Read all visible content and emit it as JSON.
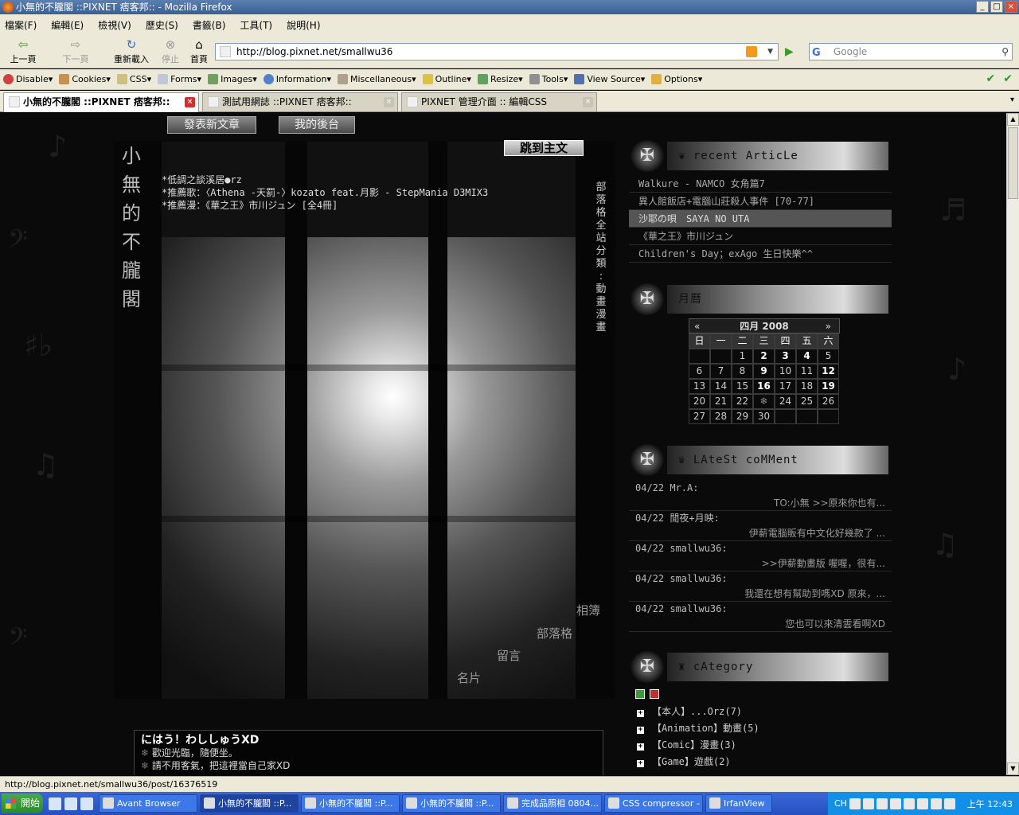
{
  "window": {
    "title": "小無的不朧閣 ::PIXNET 痞客邦:: - Mozilla Firefox"
  },
  "menu": [
    "檔案(F)",
    "編輯(E)",
    "檢視(V)",
    "歷史(S)",
    "書籤(B)",
    "工具(T)",
    "說明(H)"
  ],
  "nav": {
    "back": "上一頁",
    "forward": "下一頁",
    "reload": "重新載入",
    "stop": "停止",
    "home": "首頁",
    "url": "http://blog.pixnet.net/smallwu36",
    "search_placeholder": "Google"
  },
  "devbar": [
    "Disable▾",
    "Cookies▾",
    "CSS▾",
    "Forms▾",
    "Images▾",
    "Information▾",
    "Miscellaneous▾",
    "Outline▾",
    "Resize▾",
    "Tools▾",
    "View Source▾",
    "Options▾"
  ],
  "tabs": [
    "小無的不朧閣 ::PIXNET 痞客邦::",
    "測試用網誌 ::PIXNET 痞客邦::",
    "PIXNET 管理介面 :: 編輯CSS"
  ],
  "blog": {
    "btn_new_post": "發表新文章",
    "btn_backend": "我的後台",
    "btn_jump": "跳到主文",
    "title_chars": [
      "小",
      "無",
      "的",
      "不",
      "朧",
      "閣"
    ],
    "motto": [
      "*低調之談溪居●rz",
      "*推薦歌：〈Athena -天罰-〉kozato feat.月影 - StepMania D3MIX3",
      "*推薦漫：《華之王》市川ジュン [全4冊]"
    ],
    "breadcrumb_chars": [
      "部",
      "落",
      "格",
      "全",
      "站",
      "分",
      "類",
      ":",
      "動",
      "畫",
      "漫",
      "畫"
    ],
    "banner_nav": {
      "album": "相簿",
      "blog": "部落格",
      "guestbook": "留言",
      "card": "名片"
    },
    "welcome": {
      "title": "にはう！わししゅうXD",
      "lines": [
        "歡迎光臨，隨便坐。",
        "請不用客氣，把這裡當自己家XD"
      ]
    }
  },
  "sidebar": {
    "recent": {
      "title": "❦ recent ArticLe",
      "items": [
        "Walkure - NAMCO 女角篇7",
        "異人館飯店+電腦山莊殺人事件 [70-77]",
        "沙耶の唄　SAYA NO UTA",
        "《華之王》市川ジュン",
        "Children's Day；exAgo 生日快樂^^"
      ]
    },
    "calendar": {
      "title": "月曆",
      "prev": "«",
      "next": "»",
      "month": "四月 2008",
      "dow": [
        "日",
        "一",
        "二",
        "三",
        "四",
        "五",
        "六"
      ],
      "weeks": [
        [
          "",
          "",
          "1",
          "2",
          "3",
          "4",
          "5"
        ],
        [
          "6",
          "7",
          "8",
          "9",
          "10",
          "11",
          "12"
        ],
        [
          "13",
          "14",
          "15",
          "16",
          "17",
          "18",
          "19"
        ],
        [
          "20",
          "21",
          "22",
          "❄",
          "24",
          "25",
          "26"
        ],
        [
          "27",
          "28",
          "29",
          "30",
          "",
          "",
          ""
        ]
      ]
    },
    "comments": {
      "title": "♛ LAteSt coMMent",
      "items": [
        {
          "who": "04/22 Mr.A:",
          "text": "TO:小無 >>原來你也有..."
        },
        {
          "who": "04/22 閒夜+月映:",
          "text": "伊薪電腦販有中文化好幾款了 ..."
        },
        {
          "who": "04/22 smallwu36:",
          "text": ">>伊薪動畫版 喔喔，很有..."
        },
        {
          "who": "04/22 smallwu36:",
          "text": "我還在想有幫助到嗎XD 原來，..."
        },
        {
          "who": "04/22 smallwu36:",
          "text": "您也可以來清雲看啊XD"
        }
      ]
    },
    "category": {
      "title": "♜ cAtegory",
      "items": [
        "【本人】...Orz(7)",
        "【Animation】動畫(5)",
        "【Comic】漫畫(3)",
        "【Game】遊戲(2)"
      ]
    }
  },
  "status": "http://blog.pixnet.net/smallwu36/post/16376519",
  "taskbar": {
    "start": "開始",
    "items": [
      "Avant Browser",
      "小無的不朧閣 ::P...",
      "小無的不朧閣 ::P...",
      "小無的不朧閣 ::P...",
      "完成品照相 0804...",
      "CSS compressor - ...",
      "IrfanView"
    ],
    "lang": "CH",
    "clock": "上午 12:43"
  }
}
